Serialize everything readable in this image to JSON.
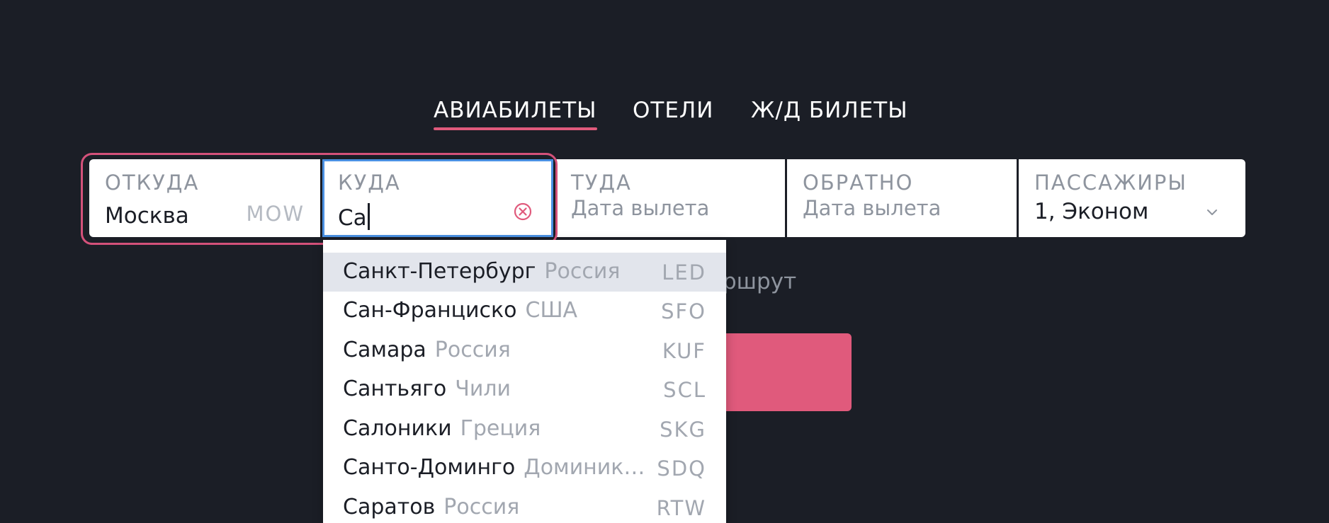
{
  "tabs": [
    {
      "label": "АВИАБИЛЕТЫ",
      "active": true
    },
    {
      "label": "ОТЕЛИ",
      "active": false
    },
    {
      "label": "Ж/Д БИЛЕТЫ",
      "active": false
    }
  ],
  "search": {
    "from": {
      "label": "ОТКУДА",
      "value": "Москва",
      "code": "MOW"
    },
    "to": {
      "label": "КУДА",
      "value": "Са"
    },
    "depart": {
      "label": "ТУДА",
      "placeholder": "Дата вылета"
    },
    "return": {
      "label": "ОБРАТНО",
      "placeholder": "Дата вылета"
    },
    "passengers": {
      "label": "ПАССАЖИРЫ",
      "value": "1, Эконом"
    }
  },
  "behind_text": "ршрут",
  "suggestions": [
    {
      "city": "Санкт-Петербург",
      "country": "Россия",
      "code": "LED",
      "highlighted": true
    },
    {
      "city": "Сан-Франциско",
      "country": "США",
      "code": "SFO",
      "highlighted": false
    },
    {
      "city": "Самара",
      "country": "Россия",
      "code": "KUF",
      "highlighted": false
    },
    {
      "city": "Сантьяго",
      "country": "Чили",
      "code": "SCL",
      "highlighted": false
    },
    {
      "city": "Салоники",
      "country": "Греция",
      "code": "SKG",
      "highlighted": false
    },
    {
      "city": "Санто-Доминго",
      "country": "Доминик…",
      "code": "SDQ",
      "highlighted": false
    },
    {
      "city": "Саратов",
      "country": "Россия",
      "code": "RTW",
      "highlighted": false
    }
  ],
  "colors": {
    "background": "#1b1e26",
    "accent": "#e05a7c",
    "focus": "#4a90e2",
    "highlight_row": "#e2e5ec"
  },
  "icons": {
    "clear": "clear-circle-x-icon",
    "passengers_dropdown": "chevron-down-icon"
  }
}
